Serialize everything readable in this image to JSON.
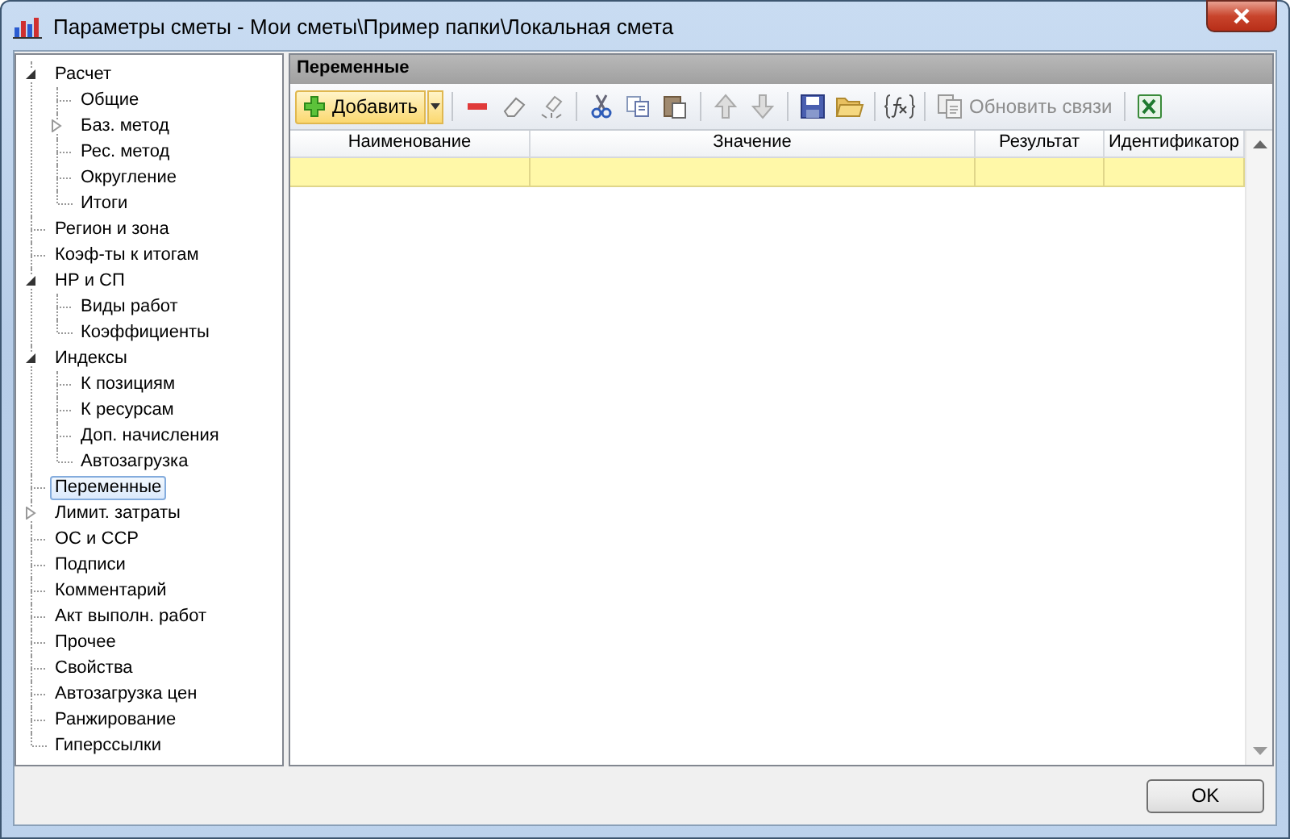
{
  "window": {
    "title": "Параметры сметы - Мои сметы\\Пример папки\\Локальная смета"
  },
  "tree": [
    {
      "label": "Расчет",
      "selected": false,
      "expanded": true,
      "children": [
        {
          "label": "Общие",
          "selected": false
        },
        {
          "label": "Баз. метод",
          "selected": false,
          "expanded": false
        },
        {
          "label": "Рес. метод",
          "selected": false
        },
        {
          "label": "Округление",
          "selected": false
        },
        {
          "label": "Итоги",
          "selected": false
        }
      ]
    },
    {
      "label": "Регион и зона",
      "selected": false
    },
    {
      "label": "Коэф-ты к итогам",
      "selected": false
    },
    {
      "label": "НР и СП",
      "selected": false,
      "expanded": true,
      "children": [
        {
          "label": "Виды работ",
          "selected": false
        },
        {
          "label": "Коэффициенты",
          "selected": false
        }
      ]
    },
    {
      "label": "Индексы",
      "selected": false,
      "expanded": true,
      "children": [
        {
          "label": "К позициям",
          "selected": false
        },
        {
          "label": "К ресурсам",
          "selected": false
        },
        {
          "label": "Доп. начисления",
          "selected": false
        },
        {
          "label": "Автозагрузка",
          "selected": false
        }
      ]
    },
    {
      "label": "Переменные",
      "selected": true
    },
    {
      "label": "Лимит. затраты",
      "selected": false,
      "expanded": false
    },
    {
      "label": "ОС и ССР",
      "selected": false
    },
    {
      "label": "Подписи",
      "selected": false
    },
    {
      "label": "Комментарий",
      "selected": false
    },
    {
      "label": "Акт выполн. работ",
      "selected": false
    },
    {
      "label": "Прочее",
      "selected": false
    },
    {
      "label": "Свойства",
      "selected": false
    },
    {
      "label": "Автозагрузка цен",
      "selected": false
    },
    {
      "label": "Ранжирование",
      "selected": false
    },
    {
      "label": "Гиперссылки",
      "selected": false
    }
  ],
  "panel": {
    "title": "Переменные"
  },
  "toolbar": {
    "add_button": {
      "label": "Добавить"
    },
    "refresh_button": {
      "label": "Обновить связи",
      "disabled": true
    }
  },
  "table": {
    "columns": [
      "Наименование",
      "Значение",
      "Результат",
      "Идентификатор"
    ],
    "rows": [
      {
        "selected": true
      }
    ]
  },
  "buttons": [
    {
      "label": "OK"
    }
  ]
}
